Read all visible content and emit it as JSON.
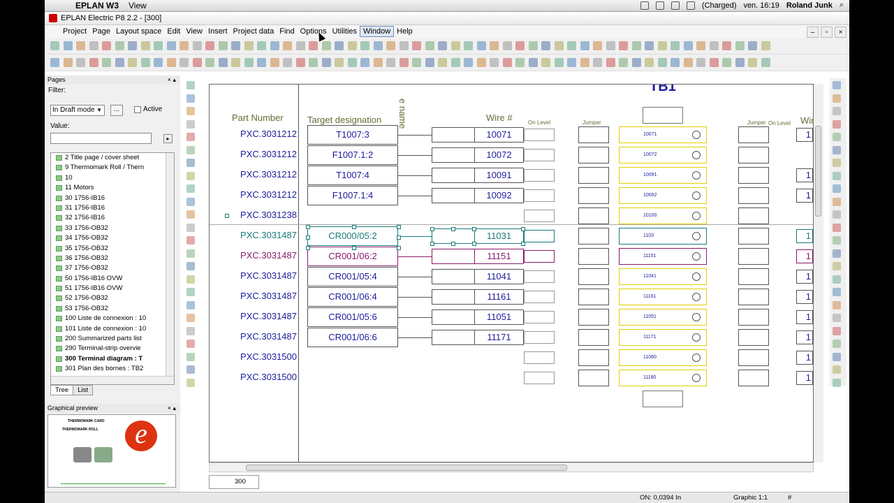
{
  "macbar": {
    "app_name": "EPLAN W3",
    "menu_view": "View",
    "battery": "(Charged)",
    "clock": "ven. 16:19",
    "user": "Roland Junk"
  },
  "window": {
    "title": "EPLAN Electric P8 2.2 - [300]"
  },
  "menu": {
    "items": [
      "Project",
      "Page",
      "Layout space",
      "Edit",
      "View",
      "Insert",
      "Project data",
      "Find",
      "Options",
      "Utilities",
      "Window",
      "Help"
    ]
  },
  "pages_panel": {
    "title": "Pages",
    "filter_label": "Filter:",
    "filter_value": "In Draft mode",
    "dots_label": "...",
    "active_label": "Active",
    "value_label": "Value:",
    "tree": [
      "2 Title page / cover sheet",
      "9 Thermomark Roll / Thern",
      "10",
      "11 Motors",
      "30 1756-IB16",
      "31 1756-IB16",
      "32 1756-IB16",
      "33 1756-OB32",
      "34 1756-OB32",
      "35 1756-OB32",
      "36 1756-OB32",
      "37 1756-OB32",
      "50 1756-IB16 OVW",
      "51 1756-IB16 OVW",
      "52 1756-OB32",
      "53 1756-OB32",
      "100 Liste de connexion : 10",
      "101 Liste de connexion : 10",
      "200 Summarized parts list",
      "290 Terminal-strip overvie",
      "300 Terminal diagram : T",
      "301 Plan des bornes : TB2",
      "302 Terminal diagram : X1"
    ],
    "tab_tree": "Tree",
    "tab_list": "List"
  },
  "preview_panel": {
    "title": "Graphical preview",
    "line1": "THERMOMARK CARD",
    "line2": "THERMOMARK ROLL"
  },
  "diagram": {
    "title_fragment": "TB1",
    "rotated_fragment": "e name",
    "hdr_part": "Part Number",
    "hdr_target": "Target designation",
    "hdr_wire": "Wire #",
    "hdr_onlevel": "On Level",
    "hdr_jumper": "Jumper",
    "hdr_jumper2": "Jumper",
    "hdr_onlevel2": "On Level",
    "hdr_wire2": "Wir",
    "rows": [
      {
        "part": "PXC.3031212",
        "target": "T1007:3",
        "wire": "10071",
        "term": "10071"
      },
      {
        "part": "PXC.3031212",
        "target": "F1007.1:2",
        "wire": "10072",
        "term": "10072"
      },
      {
        "part": "PXC.3031212",
        "target": "T1007:4",
        "wire": "10091",
        "term": "10091"
      },
      {
        "part": "PXC.3031212",
        "target": "F1007.1:4",
        "wire": "10092",
        "term": "10092"
      },
      {
        "part": "PXC.3031238",
        "target": "",
        "wire": "",
        "term": "10100"
      },
      {
        "part": "PXC.3031487",
        "target": "CR000/05:2",
        "wire": "11031",
        "term": "1103"
      },
      {
        "part": "PXC.3031487",
        "target": "CR001/06:2",
        "wire": "11151",
        "term": "11151"
      },
      {
        "part": "PXC.3031487",
        "target": "CR001/05:4",
        "wire": "11041",
        "term": "11041"
      },
      {
        "part": "PXC.3031487",
        "target": "CR001/06:4",
        "wire": "11161",
        "term": "11161"
      },
      {
        "part": "PXC.3031487",
        "target": "CR001/05:6",
        "wire": "11051",
        "term": "11051"
      },
      {
        "part": "PXC.3031487",
        "target": "CR001/06:6",
        "wire": "11171",
        "term": "11171"
      },
      {
        "part": "PXC.3031500",
        "target": "",
        "wire": "",
        "term": "11060"
      },
      {
        "part": "PXC.3031500",
        "target": "",
        "wire": "",
        "term": "11180"
      }
    ],
    "right_col": [
      "1",
      "",
      "1",
      "1",
      "",
      "1",
      "1",
      "1",
      "1",
      "1",
      "1",
      "1",
      "1"
    ]
  },
  "page_tab": "300",
  "status": {
    "on": "ON: 0,0394 In",
    "graphic": "Graphic 1:1",
    "hash": "#"
  },
  "colors": {
    "text_blue": "#1c1c9c",
    "header_olive": "#6b6b35",
    "terminal_yellow": "#e0d000",
    "selected_teal": "#1a7a7a",
    "selected_row_magenta": "#8a1a6a"
  }
}
